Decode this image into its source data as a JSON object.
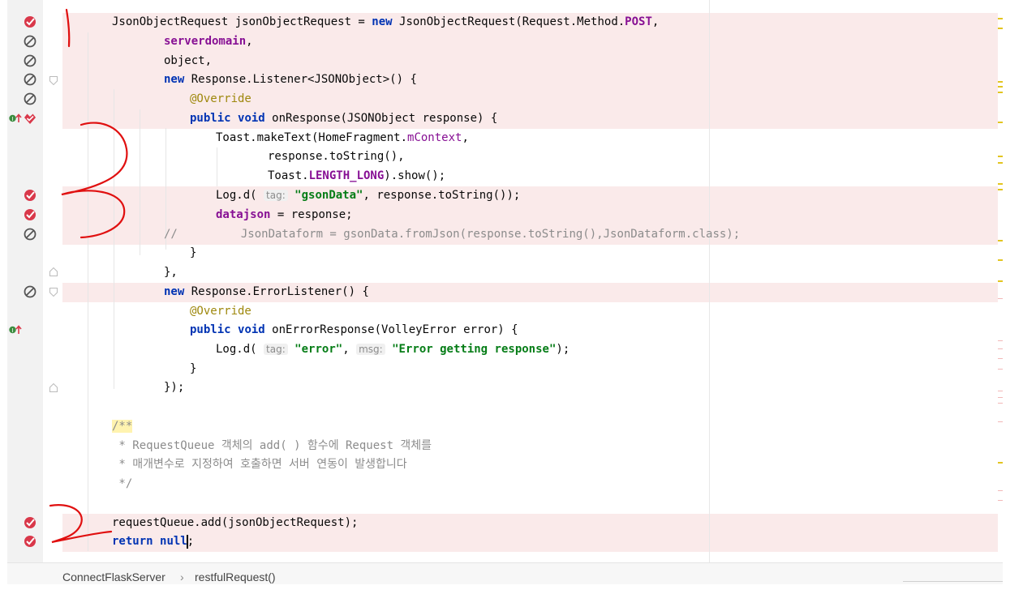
{
  "editor": {
    "lines": [
      "JsonObjectRequest jsonObjectRequest = new JsonObjectRequest(Request.Method.POST,",
      "serverdomain,",
      "object,",
      "new Response.Listener<JSONObject>() {",
      "@Override",
      "public void onResponse(JSONObject response) {",
      "Toast.makeText(HomeFragment.mContext,",
      "response.toString(),",
      "Toast.LENGTH_LONG).show();",
      "Log.d( tag: \"gsonData\", response.toString());",
      "datajson = response;",
      "//        JsonDataform = gsonData.fromJson(response.toString(),JsonDataform.class);",
      "}",
      "},",
      "new Response.ErrorListener() {",
      "@Override",
      "public void onErrorResponse(VolleyError error) {",
      "Log.d( tag: \"error\", msg: \"Error getting response\");",
      "}",
      "});",
      "",
      "/**",
      " * RequestQueue 객체의 add( ) 함수에 Request 객체를",
      " * 매개변수로 지정하여 호출하면 서버 연동이 발생합니다",
      " */",
      "",
      "requestQueue.add(jsonObjectRequest);",
      "return null;"
    ],
    "tokens": {
      "new": "new",
      "public": "public",
      "void": "void",
      "return": "return",
      "null": "null",
      "override": "@Override",
      "post": "POST",
      "serverdomain": "serverdomain",
      "mcontext": "mContext",
      "length_long": "LENGTH_LONG",
      "datajson": "datajson",
      "tag_hint": "tag:",
      "msg_hint": "msg:",
      "str_gsondata": "\"gsonData\"",
      "str_error": "\"error\"",
      "str_error_msg": "\"Error getting response\"",
      "comment_slashes": "//",
      "comment_body": "JsonDataform = gsonData.fromJson(response.toString(),JsonDataform.class);",
      "doc_open": "/**",
      "doc_line1": " * RequestQueue 객체의 add( ) 함수에 Request 객체를",
      "doc_line2": " * 매개변수로 지정하여 호출하면 서버 연동이 발생합니다",
      "doc_close": " */",
      "t_jor_decl": "JsonObjectRequest jsonObjectRequest = ",
      "t_jor_ctor": " JsonObjectRequest(Request.Method.",
      "t_comma": ",",
      "t_object": "object,",
      "t_listener": " Response.Listener<JSONObject>() {",
      "t_onresponse": " onResponse(JSONObject response) {",
      "t_toast": "Toast.makeText(HomeFragment.",
      "t_tostring": "response.toString(),",
      "t_toast2": "Toast.",
      "t_show": ").show();",
      "t_logd": "Log.d( ",
      "t_log_rest": ", response.toString());",
      "t_assign": " = response;",
      "t_close": "}",
      "t_close_comma": "},",
      "t_errlistener": " Response.ErrorListener() {",
      "t_onerror": " onErrorResponse(VolleyError error) {",
      "t_log_end": ");",
      "t_close_paren": "});",
      "t_queue": "requestQueue.add(jsonObjectRequest);",
      "t_space": " ",
      "t_nu": "nu",
      "t_ll": "ll",
      "t_semi": ";"
    },
    "breakpoint_lines": [
      1,
      2,
      3,
      4,
      5,
      6,
      10,
      11,
      12,
      15,
      27,
      28
    ],
    "cursor": {
      "line": 28,
      "after": "return nul"
    }
  },
  "breadcrumb": {
    "class_name": "ConnectFlaskServer",
    "separator": "›",
    "method_name": "restfulRequest()"
  },
  "icons": {
    "breakpoint": "breakpoint-verified-icon",
    "disabled": "breakpoint-disabled-icon",
    "override": "override-method-icon",
    "fold": "fold-marker-icon"
  },
  "colors": {
    "breakpoint_line_bg": "#faeaea",
    "breakpoint_red": "#d9384a",
    "keyword": "#0033b3",
    "string": "#067d17",
    "field": "#871094",
    "annotation": "#9e880d",
    "comment": "#8c8c8c",
    "annotation_ink": "#e01010"
  }
}
